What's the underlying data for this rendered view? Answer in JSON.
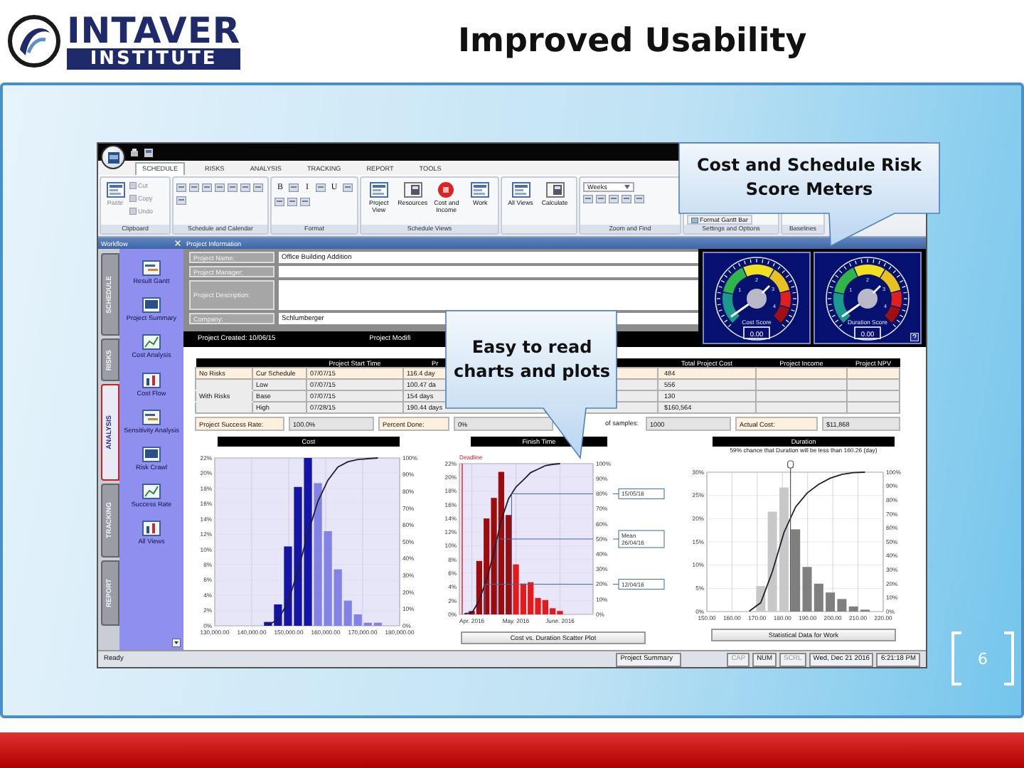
{
  "slide": {
    "logo_top": "INTAVER",
    "logo_bottom": "INSTITUTE",
    "title": "Improved Usability",
    "page_number": "6"
  },
  "callouts": [
    {
      "text": "Cost and Schedule Risk Score Meters"
    },
    {
      "text": "Easy to read charts and plots"
    }
  ],
  "app": {
    "tabs": [
      {
        "label": "SCHEDULE",
        "selected": true
      },
      {
        "label": "RISKS",
        "selected": false
      },
      {
        "label": "ANALYSIS",
        "selected": false
      },
      {
        "label": "TRACKING",
        "selected": false
      },
      {
        "label": "REPORT",
        "selected": false
      },
      {
        "label": "TOOLS",
        "selected": false
      }
    ],
    "ribbon_groups": [
      {
        "label": "Clipboard",
        "items": [
          {
            "kind": "large",
            "label": "Paste"
          },
          {
            "kind": "small",
            "label": "Cut"
          },
          {
            "kind": "small",
            "label": "Copy"
          },
          {
            "kind": "small",
            "label": "Undo"
          }
        ]
      },
      {
        "label": "Schedule and Calendar",
        "items": [
          {
            "kind": "icon"
          },
          {
            "kind": "icon"
          },
          {
            "kind": "icon"
          },
          {
            "kind": "icon"
          },
          {
            "kind": "icon"
          },
          {
            "kind": "icon"
          },
          {
            "kind": "icon"
          },
          {
            "kind": "icon"
          }
        ]
      },
      {
        "label": "Format",
        "items": [
          {
            "kind": "text",
            "label": "B"
          },
          {
            "kind": "icon"
          },
          {
            "kind": "text",
            "label": "I"
          },
          {
            "kind": "icon"
          },
          {
            "kind": "text",
            "label": "U"
          },
          {
            "kind": "icon"
          },
          {
            "kind": "icon"
          },
          {
            "kind": "icon"
          },
          {
            "kind": "icon"
          }
        ]
      },
      {
        "label": "Schedule Views",
        "items": [
          {
            "kind": "large",
            "label": "Project View"
          },
          {
            "kind": "large",
            "label": "Resources"
          },
          {
            "kind": "large",
            "label": "Cost and Income"
          },
          {
            "kind": "large",
            "label": "Work"
          }
        ]
      },
      {
        "items": [
          {
            "kind": "large",
            "label": "All Views"
          },
          {
            "kind": "large",
            "label": "Calculate"
          }
        ]
      },
      {
        "label": "Zoom and Find",
        "items": [
          {
            "kind": "dropdown",
            "label": "Weeks"
          },
          {
            "kind": "icon"
          },
          {
            "kind": "icon"
          },
          {
            "kind": "icon"
          },
          {
            "kind": "icon"
          },
          {
            "kind": "icon"
          }
        ]
      },
      {
        "label": "Settings and Options",
        "items": [
          {
            "kind": "bottom",
            "label": "Format Gantt Bar"
          }
        ]
      },
      {
        "label": "Baselines"
      }
    ],
    "workflow": {
      "title": "Workflow",
      "tabs": [
        {
          "label": "SCHEDULE",
          "selected": false
        },
        {
          "label": "RISKS",
          "selected": false
        },
        {
          "label": "ANALYSIS",
          "selected": true
        },
        {
          "label": "TRACKING",
          "selected": false
        },
        {
          "label": "REPORT",
          "selected": false
        }
      ],
      "items": [
        {
          "label": "Result Gantt"
        },
        {
          "label": "Project Summary"
        },
        {
          "label": "Cost Analysis"
        },
        {
          "label": "Cost Flow"
        },
        {
          "label": "Sensitivity Analysis"
        },
        {
          "label": "Risk Crawl"
        },
        {
          "label": "Success Rate"
        },
        {
          "label": "All Views"
        }
      ]
    },
    "project_info": {
      "title": "Project Information",
      "fields": [
        {
          "kind": "line",
          "label": "Project Name:",
          "value": "Office Building Addition"
        },
        {
          "kind": "line",
          "label": "Project Manager:"
        },
        {
          "kind": "multiline",
          "label": "Project Description:"
        },
        {
          "kind": "line",
          "label": "Company:",
          "value": "Schlumberger"
        }
      ],
      "created": "Project Created: 10/06/15",
      "modified": "Project Modifi"
    },
    "gauges": [
      {
        "label": "Cost Score",
        "value": "0.00",
        "scale_labels": [
          "1",
          "2",
          "3",
          "4"
        ]
      },
      {
        "label": "Duration Score",
        "value": "0.00",
        "scale_labels": [
          "1",
          "2",
          "3",
          "4"
        ]
      }
    ],
    "table": {
      "columns": [
        "",
        "",
        "Project Start Time",
        "Pr",
        "",
        "Total Project Cost",
        "Project Income",
        "Project NPV"
      ],
      "rows": [
        {
          "kind": "baseline",
          "cells": [
            "No Risks",
            "Cur Schedule",
            "07/07/15",
            "116.4 day",
            "",
            "484",
            "",
            ""
          ]
        },
        {
          "kind": "risk",
          "cells": [
            "",
            "Low",
            "07/07/15",
            "100.47 da",
            "",
            "556",
            "",
            ""
          ]
        },
        {
          "kind": "risk",
          "cells": [
            "With Risks",
            "Base",
            "07/07/15",
            "154 days",
            "",
            "130",
            "",
            ""
          ]
        },
        {
          "kind": "risk",
          "cells": [
            "",
            "High",
            "07/28/15",
            "190.44 days",
            "",
            "$160,564",
            "",
            ""
          ]
        }
      ]
    },
    "stats": [
      {
        "label": "Project Success Rate:",
        "value": "100.0%"
      },
      {
        "label": "Percent Done:",
        "value": "0%"
      },
      {
        "label": "of samples:",
        "value": "1000"
      },
      {
        "label": "Actual Cost:",
        "value": "$11,868"
      }
    ],
    "charts": [
      {
        "kind": "cost",
        "header": "Cost",
        "right_axis_labels": [
          "100%",
          "90%",
          "80%",
          "70%",
          "60%",
          "50%",
          "40%",
          "30%",
          "20%",
          "10%",
          "0%"
        ],
        "chart_data": {
          "type": "bar",
          "grid": true,
          "x": [
            144400,
            147100,
            149800,
            152500,
            155200,
            157900,
            160600,
            163300,
            166000,
            168700,
            171400,
            174100
          ],
          "xlim": [
            130000,
            180000
          ],
          "xticks": [
            {
              "value": 130000,
              "label": "130,000.00"
            },
            {
              "value": 140000,
              "label": "140,000.00"
            },
            {
              "value": 150000,
              "label": "150,000.00"
            },
            {
              "value": 160000,
              "label": "160,000.00"
            },
            {
              "value": 170000,
              "label": "170,000.00"
            },
            {
              "value": 180000,
              "label": "180,000.00"
            }
          ],
          "ylim": [
            0,
            22
          ],
          "yticks": [
            {
              "value": 0,
              "label": "0%"
            },
            {
              "value": 2,
              "label": "2%"
            },
            {
              "value": 4,
              "label": "4%"
            },
            {
              "value": 6,
              "label": "6%"
            },
            {
              "value": 8,
              "label": "8%"
            },
            {
              "value": 10,
              "label": "10%"
            },
            {
              "value": 12,
              "label": "12%"
            },
            {
              "value": 14,
              "label": "14%"
            },
            {
              "value": 16,
              "label": "16%"
            },
            {
              "value": 18,
              "label": "18%"
            },
            {
              "value": 20,
              "label": "20%"
            },
            {
              "value": 22,
              "label": "22%"
            }
          ],
          "series": [
            {
              "color": "#1414a8",
              "values": [
                0.5,
                2.8,
                10.4,
                18.2,
                22,
                null,
                null,
                null,
                null,
                null,
                null,
                null
              ]
            },
            {
              "color": "#8282e6",
              "values": [
                null,
                null,
                null,
                null,
                null,
                18.7,
                12.4,
                7.4,
                3.3,
                1.5,
                0.4,
                0.4
              ]
            },
            {
              "type": "line",
              "color": "#202030",
              "values": [
                0.1,
                0.8,
                3.1,
                7.2,
                12.1,
                16.3,
                19.1,
                20.8,
                21.5,
                21.8,
                21.9,
                22
              ]
            }
          ]
        }
      },
      {
        "kind": "annotated",
        "header": "Finish Time",
        "footer_button": "Cost vs. Duration Scatter Plot",
        "right_axis_labels": [
          "100%",
          "90%",
          "80%",
          "70%",
          "60%",
          "50%",
          "40%",
          "30%",
          "20%",
          "10%",
          "0%"
        ],
        "chart_data": {
          "type": "bar",
          "grid": true,
          "categories": [
            null,
            "Apr. 2016",
            null,
            null,
            null,
            null,
            null,
            "May. 2016",
            null,
            null,
            null,
            null,
            null,
            "June. 2016"
          ],
          "ylim": [
            0,
            22
          ],
          "yticks": [
            {
              "value": 0,
              "label": "0%"
            },
            {
              "value": 2,
              "label": "2%"
            },
            {
              "value": 4,
              "label": "4%"
            },
            {
              "value": 6,
              "label": "6%"
            },
            {
              "value": 8,
              "label": "8%"
            },
            {
              "value": 10,
              "label": "10%"
            },
            {
              "value": 12,
              "label": "12%"
            },
            {
              "value": 14,
              "label": "14%"
            },
            {
              "value": 16,
              "label": "16%"
            },
            {
              "value": 18,
              "label": "18%"
            },
            {
              "value": 20,
              "label": "20%"
            },
            {
              "value": 22,
              "label": "22%"
            }
          ],
          "series": [
            {
              "color": "#9c0c0c",
              "values": [
                null,
                0.5,
                7.8,
                14,
                17,
                20.8,
                14.5,
                null,
                null,
                null,
                null,
                null,
                null,
                null
              ]
            },
            {
              "color": "#e61a1a",
              "values": [
                null,
                null,
                null,
                null,
                null,
                null,
                null,
                7.3,
                4.5,
                4.7,
                2.4,
                2.1,
                0.9,
                0.5
              ]
            },
            {
              "type": "line",
              "color": "#202030",
              "values": [
                0.1,
                0.2,
                2,
                5.1,
                9,
                13.7,
                16.9,
                18.6,
                19.6,
                20.7,
                21.2,
                21.7,
                21.9,
                22
              ]
            }
          ],
          "annotations": [
            "Deadline",
            "15/05/16",
            "Mean 26/04/16",
            "12/04/16"
          ]
        }
      },
      {
        "kind": "plain",
        "header": "Duration",
        "subtitle": "59% chance that Duration will be less than 160.26 (day)",
        "footer_button": "Statistical Data for Work",
        "right_axis_labels": [
          "100%",
          "90%",
          "80%",
          "70%",
          "60%",
          "50%",
          "40%",
          "30%",
          "20%",
          "10%",
          "0%"
        ],
        "chart_data": {
          "type": "bar",
          "grid": true,
          "x": [
            166.8,
            171.4,
            176,
            180.6,
            185.2,
            189.8,
            194.4,
            199,
            203.6,
            208.2,
            212.8
          ],
          "xlim": [
            150,
            220
          ],
          "xticks": [
            {
              "value": 150,
              "label": "150.00"
            },
            {
              "value": 160,
              "label": "160.00"
            },
            {
              "value": 170,
              "label": "170.00"
            },
            {
              "value": 180,
              "label": "180.00"
            },
            {
              "value": 190,
              "label": "190.00"
            },
            {
              "value": 200,
              "label": "200.00"
            },
            {
              "value": 210,
              "label": "210.00"
            },
            {
              "value": 220,
              "label": "220.00"
            }
          ],
          "ylim": [
            0,
            30
          ],
          "yticks": [
            {
              "value": 0,
              "label": "0%"
            },
            {
              "value": 5,
              "label": "5%"
            },
            {
              "value": 10,
              "label": "10%"
            },
            {
              "value": 15,
              "label": "15%"
            },
            {
              "value": 20,
              "label": "20%"
            },
            {
              "value": 25,
              "label": "25%"
            },
            {
              "value": 30,
              "label": "30%"
            }
          ],
          "series": [
            {
              "color": "#c8c8c8",
              "values": [
                null,
                5.5,
                21.5,
                26.7,
                null,
                null,
                null,
                null,
                null,
                null,
                null
              ]
            },
            {
              "color": "#7f7f7f",
              "values": [
                null,
                null,
                null,
                null,
                17.7,
                9.6,
                6,
                4.1,
                2.7,
                1.1,
                0.4
              ]
            },
            {
              "type": "line",
              "color": "#202030",
              "values": [
                0.1,
                1.9,
                8.6,
                17,
                22.5,
                25.5,
                27.4,
                28.7,
                29.5,
                29.9,
                30
              ]
            }
          ],
          "ref_lines": [
            {
              "axis": "x",
              "value": 183.2
            }
          ]
        }
      }
    ],
    "status_bar": {
      "message": "Ready",
      "document": "Project Summary",
      "indicators": [
        {
          "label": "CAP",
          "on": false
        },
        {
          "label": "NUM",
          "on": true
        },
        {
          "label": "SCRL",
          "on": false
        }
      ],
      "date": "Wed, Dec 21 2016",
      "time": "6:21:18 PM"
    }
  }
}
